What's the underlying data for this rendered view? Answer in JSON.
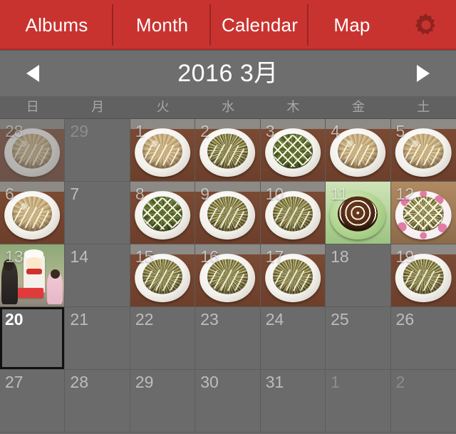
{
  "topbar": {
    "background": "#c9332f",
    "tabs": [
      {
        "label": "Albums",
        "name": "tab-albums"
      },
      {
        "label": "Month",
        "name": "tab-month"
      },
      {
        "label": "Calendar",
        "name": "tab-calendar"
      },
      {
        "label": "Map",
        "name": "tab-map"
      }
    ],
    "settings_icon": "gear-icon"
  },
  "header": {
    "prev_icon": "triangle-left-icon",
    "next_icon": "triangle-right-icon",
    "title": "2016 3月",
    "year": "2016",
    "month": "3月"
  },
  "weekdays": [
    {
      "label": "日"
    },
    {
      "label": "月"
    },
    {
      "label": "火"
    },
    {
      "label": "水"
    },
    {
      "label": "木"
    },
    {
      "label": "金"
    },
    {
      "label": "土"
    }
  ],
  "calendar": {
    "selected_day": "20",
    "highlighted_day": "1",
    "rows": [
      [
        {
          "day": "28",
          "month": "prev",
          "photo": "okonomiyaki-katsuo"
        },
        {
          "day": "29",
          "month": "prev",
          "photo": null
        },
        {
          "day": "1",
          "month": "current",
          "photo": "okonomiyaki-katsuo",
          "ring": true
        },
        {
          "day": "2",
          "month": "current",
          "photo": "okonomiyaki-mix"
        },
        {
          "day": "3",
          "month": "current",
          "photo": "okonomiyaki-green-lattice"
        },
        {
          "day": "4",
          "month": "current",
          "photo": "okonomiyaki-katsuo"
        },
        {
          "day": "5",
          "month": "current",
          "photo": "okonomiyaki-katsuo"
        }
      ],
      [
        {
          "day": "6",
          "month": "current",
          "photo": "okonomiyaki-katsuo"
        },
        {
          "day": "7",
          "month": "current",
          "photo": null
        },
        {
          "day": "8",
          "month": "current",
          "photo": "okonomiyaki-green-lattice"
        },
        {
          "day": "9",
          "month": "current",
          "photo": "okonomiyaki-mix"
        },
        {
          "day": "10",
          "month": "current",
          "photo": "okonomiyaki-mix"
        },
        {
          "day": "11",
          "month": "current",
          "photo": "okonomiyaki-green-plate-spiral"
        },
        {
          "day": "12",
          "month": "current",
          "photo": "okonomiyaki-pink-dot-plate"
        }
      ],
      [
        {
          "day": "13",
          "month": "current",
          "photo": "people-with-chef-mascot"
        },
        {
          "day": "14",
          "month": "current",
          "photo": null
        },
        {
          "day": "15",
          "month": "current",
          "photo": "okonomiyaki-mix"
        },
        {
          "day": "16",
          "month": "current",
          "photo": "okonomiyaki-mix"
        },
        {
          "day": "17",
          "month": "current",
          "photo": "okonomiyaki-mix"
        },
        {
          "day": "18",
          "month": "current",
          "photo": null
        },
        {
          "day": "19",
          "month": "current",
          "photo": "okonomiyaki-mix"
        }
      ],
      [
        {
          "day": "20",
          "month": "current",
          "photo": null,
          "selected": true
        },
        {
          "day": "21",
          "month": "current",
          "photo": null
        },
        {
          "day": "22",
          "month": "current",
          "photo": null
        },
        {
          "day": "23",
          "month": "current",
          "photo": null
        },
        {
          "day": "24",
          "month": "current",
          "photo": null
        },
        {
          "day": "25",
          "month": "current",
          "photo": null
        },
        {
          "day": "26",
          "month": "current",
          "photo": null
        }
      ],
      [
        {
          "day": "27",
          "month": "current",
          "photo": null
        },
        {
          "day": "28",
          "month": "current",
          "photo": null
        },
        {
          "day": "29",
          "month": "current",
          "photo": null
        },
        {
          "day": "30",
          "month": "current",
          "photo": null
        },
        {
          "day": "31",
          "month": "current",
          "photo": null
        },
        {
          "day": "1",
          "month": "next",
          "photo": null
        },
        {
          "day": "2",
          "month": "next",
          "photo": null
        }
      ]
    ]
  },
  "colors": {
    "accent_red": "#c9332f",
    "header_gray": "#6e6e6e",
    "grid_gray": "#6b6b6b",
    "weekday_text": "#a8a8a8",
    "selection_border": "#111111"
  }
}
